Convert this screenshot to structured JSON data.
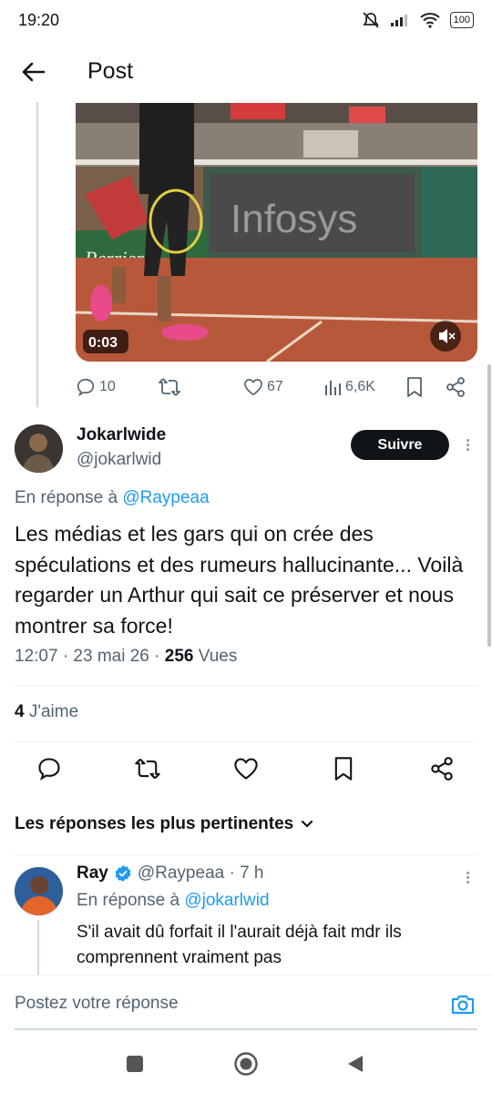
{
  "status_bar": {
    "time": "19:20",
    "battery": "100"
  },
  "header": {
    "title": "Post"
  },
  "video": {
    "duration": "0:03",
    "billboard_text": "Infosys",
    "banner_text": "Perrier"
  },
  "quoted_actions": {
    "replies": "10",
    "likes": "67",
    "views": "6,6K"
  },
  "main_tweet": {
    "display_name": "Jokarlwide",
    "handle": "@jokarlwid",
    "follow_label": "Suivre",
    "reply_prefix": "En réponse à",
    "reply_handle": "@Raypeaa",
    "text": "Les médias et les gars qui on crée des spéculations et des rumeurs hallucinante... Voilà regarder un Arthur qui sait ce préserver et nous montrer sa force!",
    "time_date": "12:07 · 23 mai 26 ·",
    "views_count": "256",
    "views_label": "Vues",
    "likes_count": "4",
    "likes_label": "J'aime"
  },
  "replies_section": {
    "title": "Les réponses les plus pertinentes"
  },
  "reply": {
    "display_name": "Ray",
    "handle_time": "@Raypeaa · 7 h",
    "reply_prefix": "En réponse à",
    "reply_handle": "@jokarlwid",
    "text": "S'il avait dû forfait il l'aurait déjà fait mdr ils comprennent vraiment pas"
  },
  "compose": {
    "placeholder": "Postez votre réponse"
  },
  "icons": {
    "back": "arrow-left-icon",
    "reply": "speech-bubble-icon",
    "retweet": "retweet-icon",
    "like": "heart-icon",
    "views": "bar-chart-icon",
    "bookmark": "bookmark-icon",
    "share": "share-icon",
    "verified": "verified-badge-icon",
    "camera": "camera-icon"
  },
  "colors": {
    "accent": "#1d9bf0",
    "text": "#0f1419",
    "secondary": "#536471",
    "clay": "#b8583a"
  }
}
